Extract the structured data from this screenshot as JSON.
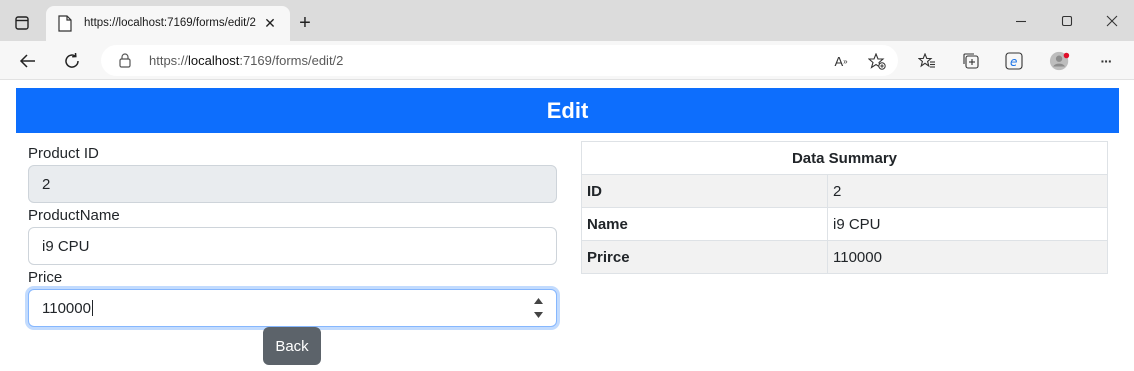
{
  "browser": {
    "tab_title": "https://localhost:7169/forms/edit/2",
    "url_prefix": "https://",
    "url_host": "localhost",
    "url_rest": ":7169/forms/edit/2",
    "icons": {
      "tab_actions": "tab-actions-icon",
      "favicon": "page-icon",
      "tab_close": "close-icon",
      "new_tab": "plus-icon",
      "back": "back-arrow-icon",
      "refresh": "refresh-icon",
      "lock": "lock-icon",
      "read_aloud": "read-aloud-icon",
      "add_favorite": "star-add-icon",
      "favorites": "favorites-icon",
      "collections": "collections-icon",
      "edge": "edge-icon",
      "profile": "profile-icon",
      "more": "more-icon",
      "minimize": "minimize-icon",
      "maximize": "maximize-icon",
      "close_window": "close-icon"
    },
    "read_aloud_glyph": "A",
    "close_glyph": "✕",
    "plus_glyph": "+",
    "more_glyph": "···"
  },
  "page": {
    "title": "Edit",
    "form": {
      "product_id_label": "Product ID",
      "product_id_value": "2",
      "product_name_label": "ProductName",
      "product_name_value": "i9 CPU",
      "price_label": "Price",
      "price_value": "110000",
      "back_label": "Back"
    },
    "summary": {
      "caption": "Data Summary",
      "rows": [
        {
          "key": "ID",
          "value": "2"
        },
        {
          "key": "Name",
          "value": "i9 CPU"
        },
        {
          "key": "Prirce",
          "value": "110000"
        }
      ]
    }
  },
  "colors": {
    "primary": "#0d6efd",
    "secondary_button": "#5c636a",
    "disabled_input": "#e9ecef",
    "focus_border": "#86b7fe"
  }
}
